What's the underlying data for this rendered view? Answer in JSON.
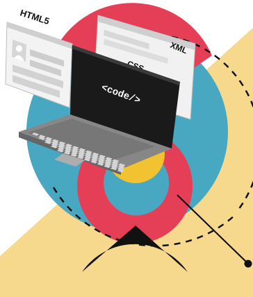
{
  "illustration": {
    "labels": {
      "html5": "HTML5",
      "css": "CSS",
      "xml": "XML",
      "code": "<code/>"
    },
    "colors": {
      "yellow_bg": "#f7d98e",
      "teal_ring": "#48a8c2",
      "red_ring": "#e43f57",
      "yellow_core": "#f2c230",
      "black": "#111111",
      "laptop_dark": "#1a1a1a",
      "laptop_gray": "#8f8f8f",
      "paper_white": "#f3f3f3",
      "paper_gray": "#cfcfcf"
    },
    "icons": [
      "browser-window-icon",
      "laptop-icon",
      "dashed-arc-icon",
      "line-node-icon"
    ]
  }
}
